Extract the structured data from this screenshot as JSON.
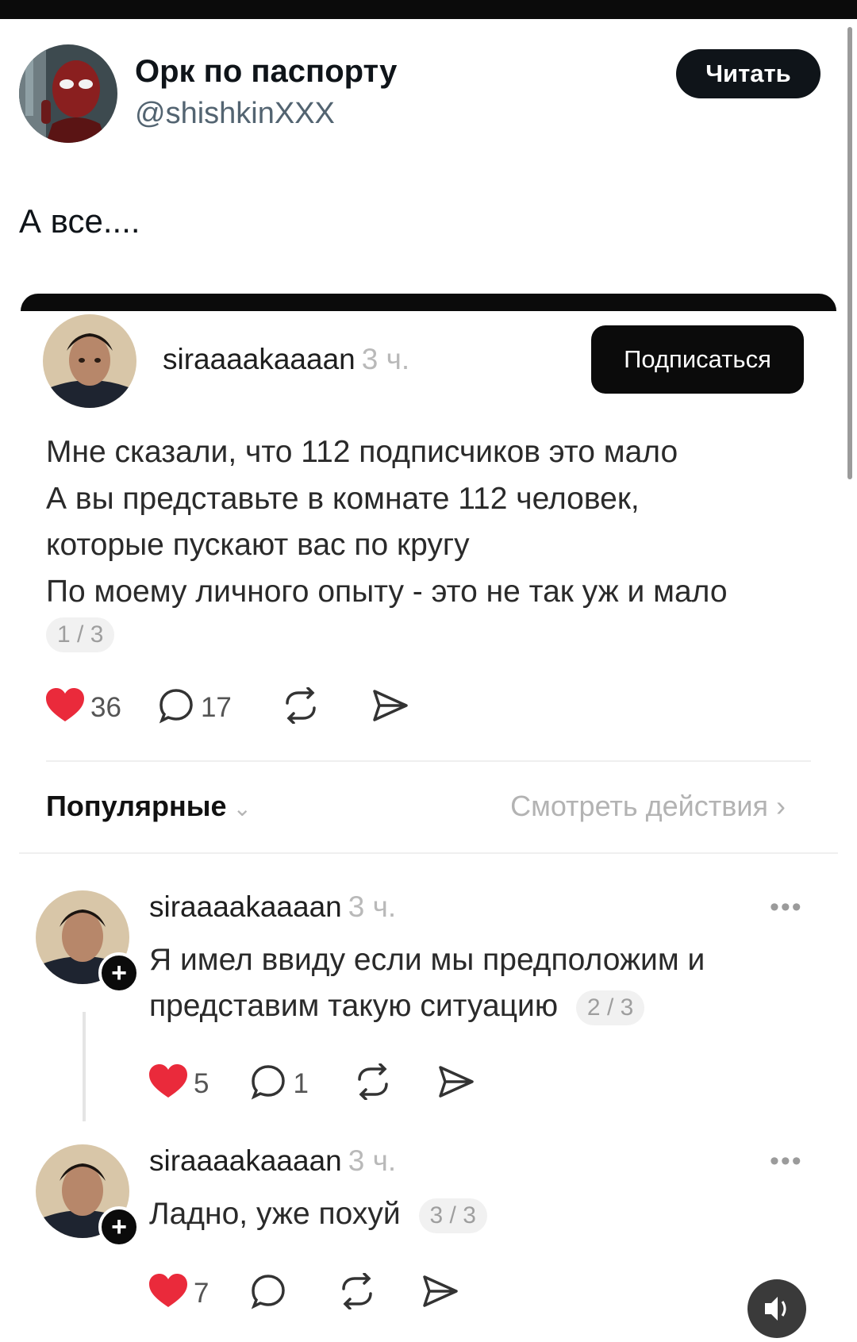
{
  "tweet": {
    "display_name": "Орк по паспорту",
    "handle": "@shishkinXXX",
    "follow_label": "Читать",
    "text": "А все...."
  },
  "embedded_post": {
    "username": "siraaaakaaaan",
    "time": "3 ч.",
    "subscribe_label": "Подписаться",
    "lines": [
      "Мне сказали, что 112 подписчиков это мало",
      "А вы представьте в комнате 112 человек,",
      "которые пускают вас по кругу",
      "По моему личного опыту - это не так уж и мало"
    ],
    "page": "1 / 3",
    "likes": "36",
    "comments": "17",
    "sort_label": "Популярные",
    "view_activity_label": "Смотреть действия"
  },
  "comments": [
    {
      "username": "siraaaakaaaan",
      "time": "3 ч.",
      "lines": [
        "Я имел ввиду если мы предположим и",
        "представим такую ситуацию"
      ],
      "page": "2 / 3",
      "likes": "5",
      "comments": "1"
    },
    {
      "username": "siraaaakaaaan",
      "time": "3 ч.",
      "lines": [
        "Ладно, уже похуй"
      ],
      "page": "3 / 3",
      "likes": "7",
      "comments": ""
    }
  ],
  "icons": {
    "like": "heart-icon",
    "comment": "comment-bubble-icon",
    "repost": "repost-icon",
    "share": "send-icon",
    "more": "more-dots-icon",
    "follow_user": "plus-icon",
    "sound": "speaker-icon"
  },
  "colors": {
    "heart": "#ea2a3b",
    "button_dark": "#0f1419",
    "handle_gray": "#536471",
    "muted": "#b3b3b3"
  }
}
